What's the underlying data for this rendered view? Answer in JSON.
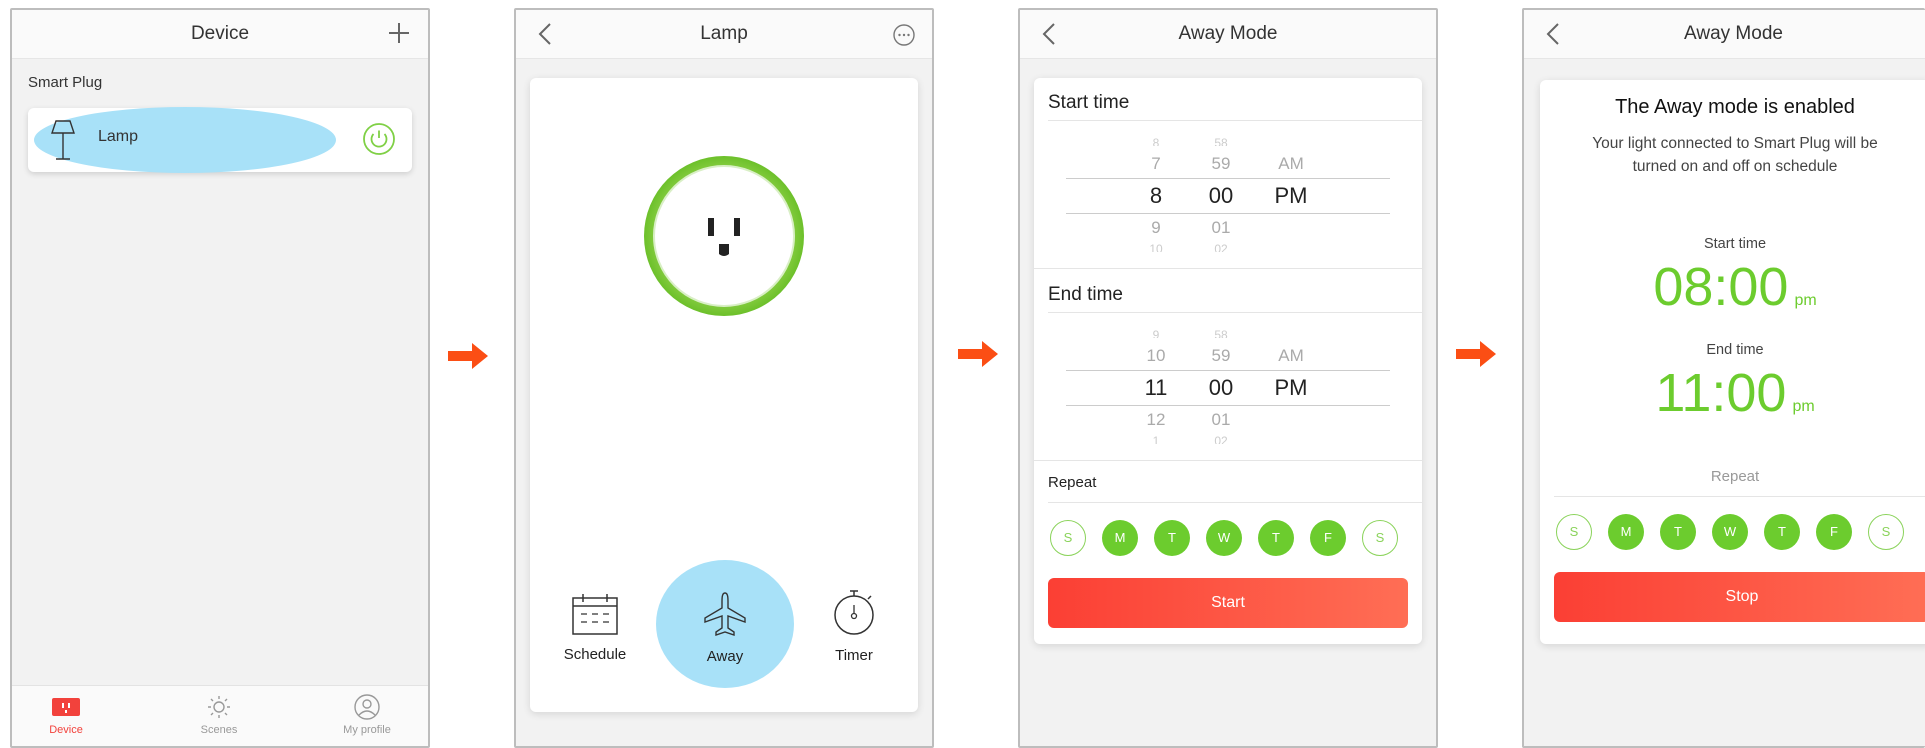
{
  "colors": {
    "green": "#6ccc2e",
    "red": "#fb3f34",
    "arrow": "#fb4e14",
    "highlight": "#a8e1f8"
  },
  "screen1": {
    "title": "Device",
    "section": "Smart Plug",
    "device_name": "Lamp",
    "tabs": [
      {
        "label": "Device",
        "icon": "plug-icon",
        "active": true
      },
      {
        "label": "Scenes",
        "icon": "sun-icon",
        "active": false
      },
      {
        "label": "My profile",
        "icon": "profile-icon",
        "active": false
      }
    ]
  },
  "screen2": {
    "title": "Lamp",
    "modes": [
      {
        "label": "Schedule",
        "icon": "calendar-icon"
      },
      {
        "label": "Away",
        "icon": "airplane-icon"
      },
      {
        "label": "Timer",
        "icon": "stopwatch-icon"
      }
    ]
  },
  "screen3": {
    "title": "Away Mode",
    "start_label": "Start time",
    "end_label": "End time",
    "start_picker": {
      "above": [
        "8",
        "58",
        ""
      ],
      "prev": [
        "7",
        "59",
        "AM"
      ],
      "selected": [
        "8",
        "00",
        "PM"
      ],
      "next": [
        "9",
        "01",
        ""
      ],
      "below": [
        "10",
        "02",
        ""
      ]
    },
    "end_picker": {
      "above": [
        "9",
        "58",
        ""
      ],
      "prev": [
        "10",
        "59",
        "AM"
      ],
      "selected": [
        "11",
        "00",
        "PM"
      ],
      "next": [
        "12",
        "01",
        ""
      ],
      "below": [
        "1",
        "02",
        ""
      ]
    },
    "repeat_label": "Repeat",
    "days": [
      {
        "label": "S",
        "on": false
      },
      {
        "label": "M",
        "on": true
      },
      {
        "label": "T",
        "on": true
      },
      {
        "label": "W",
        "on": true
      },
      {
        "label": "T",
        "on": true
      },
      {
        "label": "F",
        "on": true
      },
      {
        "label": "S",
        "on": false
      }
    ],
    "button": "Start"
  },
  "screen4": {
    "title": "Away Mode",
    "heading": "The Away mode is enabled",
    "description": "Your light connected to Smart Plug will be turned on and off on schedule",
    "start_label": "Start time",
    "start_time": "08:00",
    "start_unit": "pm",
    "end_label": "End time",
    "end_time": "11:00",
    "end_unit": "pm",
    "repeat_label": "Repeat",
    "days": [
      {
        "label": "S",
        "on": false
      },
      {
        "label": "M",
        "on": true
      },
      {
        "label": "T",
        "on": true
      },
      {
        "label": "W",
        "on": true
      },
      {
        "label": "T",
        "on": true
      },
      {
        "label": "F",
        "on": true
      },
      {
        "label": "S",
        "on": false
      }
    ],
    "button": "Stop"
  }
}
